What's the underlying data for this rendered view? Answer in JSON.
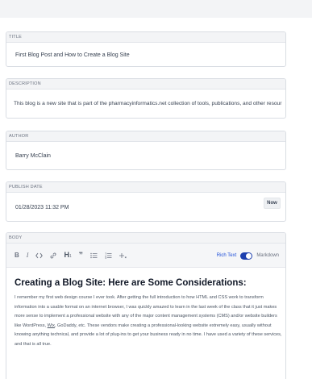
{
  "fields": {
    "title": {
      "label": "TITLE",
      "value": "First Blog Post and How to Create a Blog Site"
    },
    "description": {
      "label": "DESCRIPTION",
      "value": "This blog is a new site that is part of the pharmacyinformatics.net collection of tools, publications, and other resour"
    },
    "author": {
      "label": "AUTHOR",
      "value": "Barry McClain"
    },
    "publish_date": {
      "label": "PUBLISH DATE",
      "value": "01/28/2023 11:32 PM",
      "now_label": "Now"
    }
  },
  "body": {
    "label": "BODY",
    "toolbar": {
      "icons": [
        "bold-icon",
        "italic-icon",
        "code-icon",
        "link-icon",
        "heading-icon",
        "quote-icon",
        "bullet-list-icon",
        "ordered-list-icon",
        "more-icon"
      ],
      "rich_text_label": "Rich Text",
      "markdown_label": "Markdown",
      "mode": "rich-text",
      "accent": "#1e40af"
    },
    "heading": "Creating a Blog Site: Here are Some Considerations:",
    "paragraph_before": "I remember my first web design course I ever took. After getting the full introduction to how HTML and CSS work to transform information into a usable format on an internet browser, I was quickly amazed to learn in the last week of the class that it just makes more sense to implement a professional website with any of the major content management systems (CMS) and/or website builders like WordPress, ",
    "paragraph_link": "Wix",
    "paragraph_after": ", GoDaddy, etc. These vendors make creating a professional-looking website extremely easy, usually without knowing anything technical, and provide a lot of plug-ins to get your business ready in no time. I have used a variety of these services, and that is all true."
  }
}
